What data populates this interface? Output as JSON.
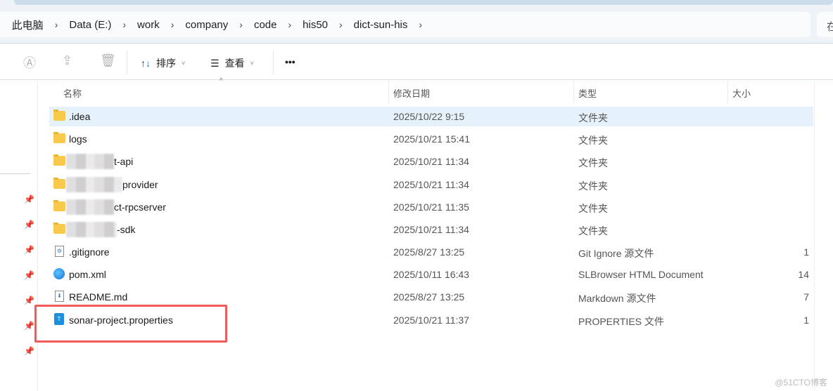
{
  "breadcrumb": [
    "此电脑",
    "Data (E:)",
    "work",
    "company",
    "code",
    "his50",
    "dict-sun-his"
  ],
  "search_partial": "在",
  "toolbar": {
    "sort": "排序",
    "view": "查看",
    "more": "•••"
  },
  "columns": {
    "name": "名称",
    "date": "修改日期",
    "type": "类型",
    "size": "大小"
  },
  "files": [
    {
      "name": ".idea",
      "date": "2025/10/22 9:15",
      "type": "文件夹",
      "size": "",
      "icon": "folder-icon",
      "selected": true
    },
    {
      "name": "logs",
      "date": "2025/10/21 15:41",
      "type": "文件夹",
      "size": "",
      "icon": "folder-icon"
    },
    {
      "name": "t-api",
      "date": "2025/10/21 11:34",
      "type": "文件夹",
      "size": "",
      "icon": "folder-icon",
      "blurred": true
    },
    {
      "name": "provider",
      "date": "2025/10/21 11:34",
      "type": "文件夹",
      "size": "",
      "icon": "folder-icon",
      "blurred": true
    },
    {
      "name": "ct-rpcserver",
      "date": "2025/10/21 11:35",
      "type": "文件夹",
      "size": "",
      "icon": "folder-icon",
      "blurred": true
    },
    {
      "name": "-sdk",
      "date": "2025/10/21 11:34",
      "type": "文件夹",
      "size": "",
      "icon": "folder-icon",
      "blurred": true
    },
    {
      "name": ".gitignore",
      "date": "2025/8/27 13:25",
      "type": "Git Ignore 源文件",
      "size": "1",
      "icon": "gear-file-icon"
    },
    {
      "name": "pom.xml",
      "date": "2025/10/11 16:43",
      "type": "SLBrowser HTML Document",
      "size": "14",
      "icon": "browser-icon"
    },
    {
      "name": "README.md",
      "date": "2025/8/27 13:25",
      "type": "Markdown 源文件",
      "size": "7",
      "icon": "markdown-file-icon"
    },
    {
      "name": "sonar-project.properties",
      "date": "2025/10/21 11:37",
      "type": "PROPERTIES 文件",
      "size": "1",
      "icon": "text-file-icon"
    }
  ],
  "watermark": "@51CTO博客",
  "highlight_color": "#f15a5a"
}
